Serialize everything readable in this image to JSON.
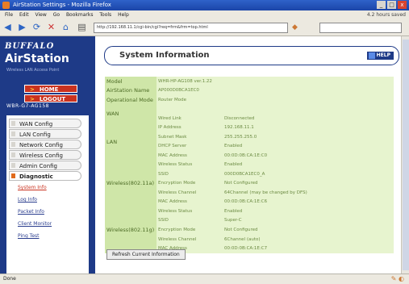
{
  "window": {
    "title": "AirStation Settings - Mozilla Firefox",
    "buttons": [
      "_",
      "□",
      "x"
    ]
  },
  "browser_menu": {
    "items": [
      "File",
      "Edit",
      "View",
      "Go",
      "Bookmarks",
      "Tools",
      "Help"
    ],
    "right_text": "4.2 hours saved"
  },
  "navbar": {
    "url": "http://192.168.11.1/cgi-bin/cgi?req=frm&frm=top.html",
    "icons": [
      "back-icon",
      "forward-icon",
      "reload-icon",
      "stop-icon",
      "home-icon"
    ]
  },
  "sidebar": {
    "logo": "BUFFALO",
    "brand": "AirStation",
    "tagline": "Wireless LAN Access Point",
    "home_button": "HOME",
    "logout_button": "LOGOUT",
    "model": "WBR-G7-AG158",
    "menu": [
      {
        "label": "WAN Config"
      },
      {
        "label": "LAN Config"
      },
      {
        "label": "Network Config"
      },
      {
        "label": "Wireless Config"
      },
      {
        "label": "Admin Config"
      },
      {
        "label": "Diagnostic"
      }
    ],
    "submenu": [
      {
        "label": "System Info"
      },
      {
        "label": "Log Info"
      },
      {
        "label": "Packet Info"
      },
      {
        "label": "Client Monitor"
      },
      {
        "label": "Ping Test"
      }
    ]
  },
  "main": {
    "title": "System Information",
    "help": "HELP",
    "refresh_button": "Refresh Current Information",
    "rows": [
      {
        "label": "Model",
        "key": "WHR-HP-AG108 ver.1.22",
        "value": ""
      },
      {
        "label": "AirStation Name",
        "key": "AP000D0BCA1EC0",
        "value": ""
      },
      {
        "label": "Operational Mode",
        "key": "Router Mode",
        "value": ""
      },
      {
        "label": "WAN",
        "key": "",
        "value": ""
      },
      {
        "label": "",
        "key": "Wired Link",
        "value": "Disconnected"
      },
      {
        "label": "LAN",
        "key": "IP Address",
        "value": "192.168.11.1"
      },
      {
        "label": "",
        "key": "Subnet Mask",
        "value": "255.255.255.0"
      },
      {
        "label": "",
        "key": "DHCP Server",
        "value": "Enabled"
      },
      {
        "label": "",
        "key": "MAC Address",
        "value": "00:0D:0B:CA:1E:C0"
      },
      {
        "label": "Wireless(802.11a)",
        "key": "Wireless Status",
        "value": "Enabled"
      },
      {
        "label": "",
        "key": "SSID",
        "value": "000D0BCA1EC0_A"
      },
      {
        "label": "",
        "key": "Encryption Mode",
        "value": "Not Configured"
      },
      {
        "label": "",
        "key": "Wireless Channel",
        "value": "64Channel (may be changed by DFS)"
      },
      {
        "label": "",
        "key": "MAC Address",
        "value": "00:0D:0B:CA:1E:C6"
      },
      {
        "label": "Wireless(802.11g)",
        "key": "Wireless Status",
        "value": "Enabled"
      },
      {
        "label": "",
        "key": "SSID",
        "value": "Super-C"
      },
      {
        "label": "",
        "key": "Encryption Mode",
        "value": "Not Configured"
      },
      {
        "label": "",
        "key": "Wireless Channel",
        "value": "6Channel (auto)"
      },
      {
        "label": "",
        "key": "MAC Address",
        "value": "00:0D:0B:CA:1E:C7"
      }
    ]
  },
  "statusbar": {
    "text": "Done"
  }
}
